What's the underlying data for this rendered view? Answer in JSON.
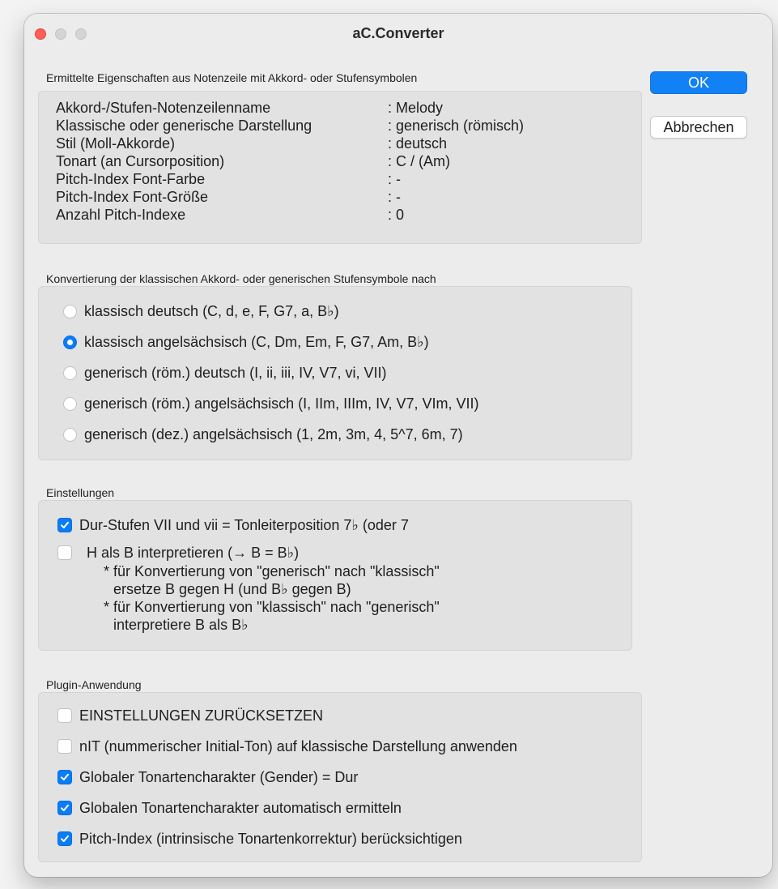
{
  "window": {
    "title": "aC.Converter"
  },
  "buttons": {
    "ok": "OK",
    "cancel": "Abbrechen"
  },
  "properties": {
    "label": "Ermittelte Eigenschaften aus Notenzeile mit Akkord- oder Stufensymbolen",
    "rows": [
      {
        "name": "Akkord-/Stufen-Notenzeilenname",
        "value": ": Melody"
      },
      {
        "name": "Klassische oder generische Darstellung",
        "value": ": generisch (römisch)"
      },
      {
        "name": "Stil (Moll-Akkorde)",
        "value": ": deutsch"
      },
      {
        "name": "Tonart (an Cursorposition)",
        "value": ": C / (Am)"
      },
      {
        "name": "Pitch-Index Font-Farbe",
        "value": ": -"
      },
      {
        "name": "Pitch-Index Font-Größe",
        "value": ": -"
      },
      {
        "name": "Anzahl Pitch-Indexe",
        "value": ": 0"
      }
    ]
  },
  "conversion": {
    "label": "Konvertierung der klassischen Akkord- oder generischen Stufensymbole nach",
    "selected_index": 1,
    "options": [
      "klassisch deutsch (C, d, e, F, G7, a, B♭)",
      "klassisch angelsächsisch (C, Dm, Em, F, G7, Am, B♭)",
      "generisch (röm.) deutsch (I, ii, iii, IV, V7, vi, VII)",
      "generisch (röm.) angelsächsisch (I, IIm, IIIm, IV, V7, VIm, VII)",
      "generisch (dez.) angelsächsisch (1, 2m, 3m, 4, 5^7, 6m, 7)"
    ]
  },
  "settings": {
    "label": "Einstellungen",
    "dur_stufen": {
      "label": "Dur-Stufen VII und vii = Tonleiterposition 7♭ (oder 7",
      "checked": true
    },
    "h_als_b": {
      "label": "H als B interpretieren (→ B = B♭)",
      "checked": false
    },
    "notes": [
      "* für Konvertierung von \"generisch\" nach \"klassisch\"",
      "ersetze B gegen H (und B♭ gegen B)",
      "* für Konvertierung von \"klassisch\" nach \"generisch\"",
      "interpretiere B als B♭"
    ]
  },
  "plugin": {
    "label": "Plugin-Anwendung",
    "items": [
      {
        "label": "EINSTELLUNGEN ZURÜCKSETZEN",
        "checked": false
      },
      {
        "label": "nIT (nummerischer Initial-Ton) auf klassische Darstellung anwenden",
        "checked": false
      },
      {
        "label": "Globaler Tonartencharakter (Gender) = Dur",
        "checked": true
      },
      {
        "label": "Globalen Tonartencharakter automatisch ermitteln",
        "checked": true
      },
      {
        "label": "Pitch-Index (intrinsische Tonartenkorrektur) berücksichtigen",
        "checked": true
      }
    ]
  },
  "colors": {
    "accent": "#0a7cf7",
    "close": "#ff5f57",
    "window_bg": "#ececec",
    "group_bg": "#e2e2e2"
  }
}
